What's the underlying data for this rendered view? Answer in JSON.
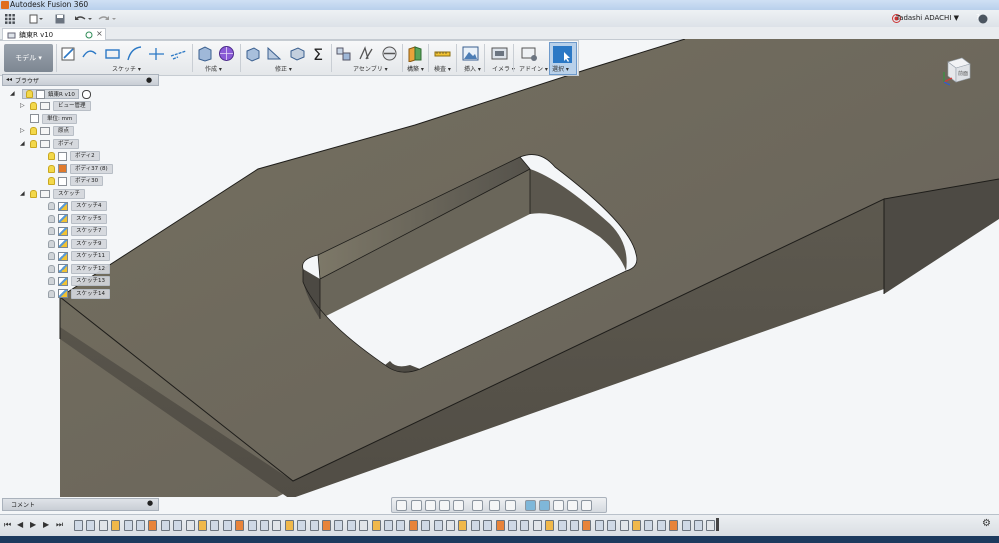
{
  "window": {
    "title": "Autodesk Fusion 360"
  },
  "user": {
    "name": "Tadashi ADACHI ▼",
    "help": "?"
  },
  "document_tab": {
    "title": "鎮東R v10"
  },
  "toolbar": {
    "workspace": "モデル ▾",
    "groups": [
      "スケッチ ▾",
      "作成 ▾",
      "修正 ▾",
      "アセンブリ ▾",
      "構築 ▾",
      "検査 ▾",
      "挿入 ▾",
      "イメラ ▾",
      "アドイン ▾",
      "選択 ▾"
    ]
  },
  "browser": {
    "title": "ブラウザ",
    "root": "鎮東R v10",
    "items": [
      {
        "label": "ビュー管理",
        "level": 1,
        "icon": "folder-icon",
        "expander": "▷"
      },
      {
        "label": "単位: mm",
        "level": 1,
        "icon": "units-icon",
        "expander": ""
      },
      {
        "label": "原点",
        "level": 1,
        "icon": "folder-icon",
        "expander": "▷"
      },
      {
        "label": "ボディ",
        "level": 1,
        "icon": "folder-icon",
        "expander": "◢"
      },
      {
        "label": "ボディ2",
        "level": 2,
        "icon": "body-icon",
        "expander": ""
      },
      {
        "label": "ボディ37 (8)",
        "level": 2,
        "icon": "body-orange-icon",
        "expander": ""
      },
      {
        "label": "ボディ30",
        "level": 2,
        "icon": "body-icon",
        "expander": ""
      },
      {
        "label": "スケッチ",
        "level": 1,
        "icon": "folder-icon",
        "expander": "◢"
      },
      {
        "label": "スケッチ4",
        "level": 2,
        "icon": "sketch-icon",
        "expander": ""
      },
      {
        "label": "スケッチ5",
        "level": 2,
        "icon": "sketch-icon",
        "expander": ""
      },
      {
        "label": "スケッチ7",
        "level": 2,
        "icon": "sketch-icon",
        "expander": ""
      },
      {
        "label": "スケッチ9",
        "level": 2,
        "icon": "sketch-icon",
        "expander": ""
      },
      {
        "label": "スケッチ11",
        "level": 2,
        "icon": "sketch-icon",
        "expander": ""
      },
      {
        "label": "スケッチ12",
        "level": 2,
        "icon": "sketch-icon",
        "expander": ""
      },
      {
        "label": "スケッチ13",
        "level": 2,
        "icon": "sketch-icon",
        "expander": ""
      },
      {
        "label": "スケッチ14",
        "level": 2,
        "icon": "sketch-icon",
        "expander": ""
      }
    ]
  },
  "comments": {
    "title": "コメント"
  },
  "viewcube": {
    "face_label": "前面"
  },
  "colors": {
    "accent": "#2b78c5",
    "model": "#6b665c",
    "background": "#f4f6f8"
  }
}
